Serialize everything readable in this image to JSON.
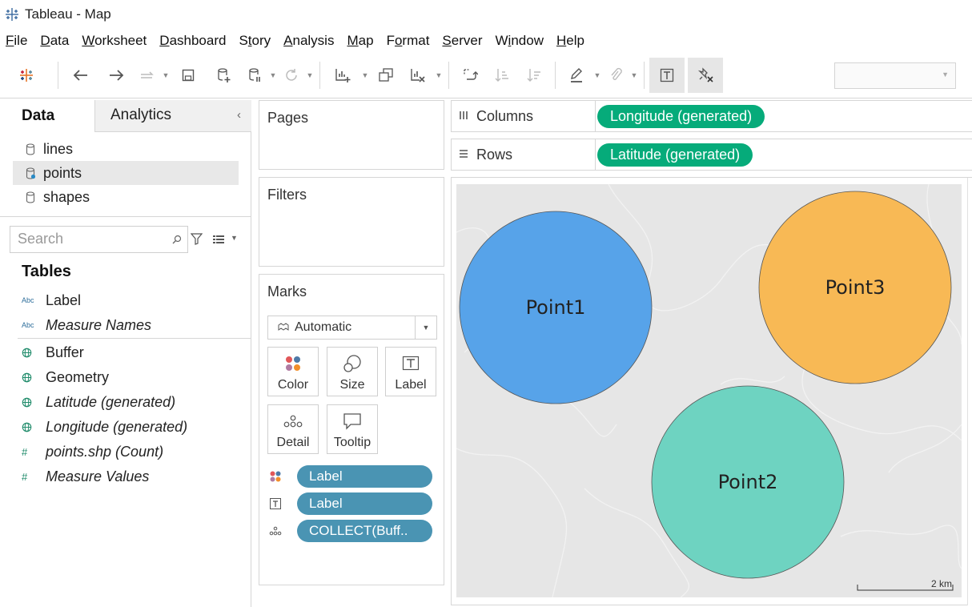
{
  "window": {
    "title": "Tableau - Map",
    "app_icon": "tableau-logo-icon"
  },
  "menu": [
    {
      "label": "File",
      "accel_index": 0
    },
    {
      "label": "Data",
      "accel_index": 0
    },
    {
      "label": "Worksheet",
      "accel_index": 0
    },
    {
      "label": "Dashboard",
      "accel_index": 0
    },
    {
      "label": "Story",
      "accel_index": 1
    },
    {
      "label": "Analysis",
      "accel_index": 0
    },
    {
      "label": "Map",
      "accel_index": 0
    },
    {
      "label": "Format",
      "accel_index": 1
    },
    {
      "label": "Server",
      "accel_index": 0
    },
    {
      "label": "Window",
      "accel_index": 1
    },
    {
      "label": "Help",
      "accel_index": 0
    }
  ],
  "toolbar": {
    "icons": [
      "tableau-icon",
      "undo-icon",
      "redo-icon",
      "replay-icon",
      "save-icon",
      "new-datasource-icon",
      "pause-updates-icon",
      "refresh-icon",
      "new-worksheet-icon",
      "duplicate-icon",
      "clear-sheet-icon",
      "swap-icon",
      "sort-ascending-icon",
      "sort-descending-icon",
      "highlight-icon",
      "group-icon",
      "show-labels-icon",
      "fix-axes-icon"
    ],
    "dropdown_value": ""
  },
  "data_pane": {
    "tabs": {
      "data": "Data",
      "analytics": "Analytics"
    },
    "collapse_glyph": "‹",
    "datasources": [
      {
        "label": "lines",
        "selected": false
      },
      {
        "label": "points",
        "selected": true
      },
      {
        "label": "shapes",
        "selected": false
      }
    ],
    "search_placeholder": "Search",
    "tables_heading": "Tables",
    "dimensions": [
      {
        "type": "Abc",
        "label": "Label",
        "italic": false
      },
      {
        "type": "Abc",
        "label": "Measure Names",
        "italic": true
      }
    ],
    "measures": [
      {
        "type": "geo",
        "label": "Buffer",
        "italic": false
      },
      {
        "type": "geo",
        "label": "Geometry",
        "italic": false
      },
      {
        "type": "geo",
        "label": "Latitude (generated)",
        "italic": true
      },
      {
        "type": "geo",
        "label": "Longitude (generated)",
        "italic": true
      },
      {
        "type": "#",
        "label": "points.shp (Count)",
        "italic": true
      },
      {
        "type": "#",
        "label": "Measure Values",
        "italic": true
      }
    ]
  },
  "cards": {
    "pages": "Pages",
    "filters": "Filters",
    "marks": {
      "title": "Marks",
      "mark_type": "Automatic",
      "buttons": [
        "Color",
        "Size",
        "Label",
        "Detail",
        "Tooltip"
      ],
      "pills": [
        {
          "icon": "color-dots-icon",
          "label": "Label"
        },
        {
          "icon": "label-text-icon",
          "label": "Label"
        },
        {
          "icon": "detail-dots-icon",
          "label": "COLLECT(Buff.."
        }
      ]
    }
  },
  "shelves": {
    "columns": {
      "label": "Columns",
      "pill": "Longitude (generated)"
    },
    "rows": {
      "label": "Rows",
      "pill": "Latitude (generated)"
    }
  },
  "map": {
    "points": [
      {
        "label": "Point1",
        "color": "#57a3e9"
      },
      {
        "label": "Point2",
        "color": "#6ed3c1"
      },
      {
        "label": "Point3",
        "color": "#f8b955"
      }
    ],
    "scale_label": "2 km"
  }
}
